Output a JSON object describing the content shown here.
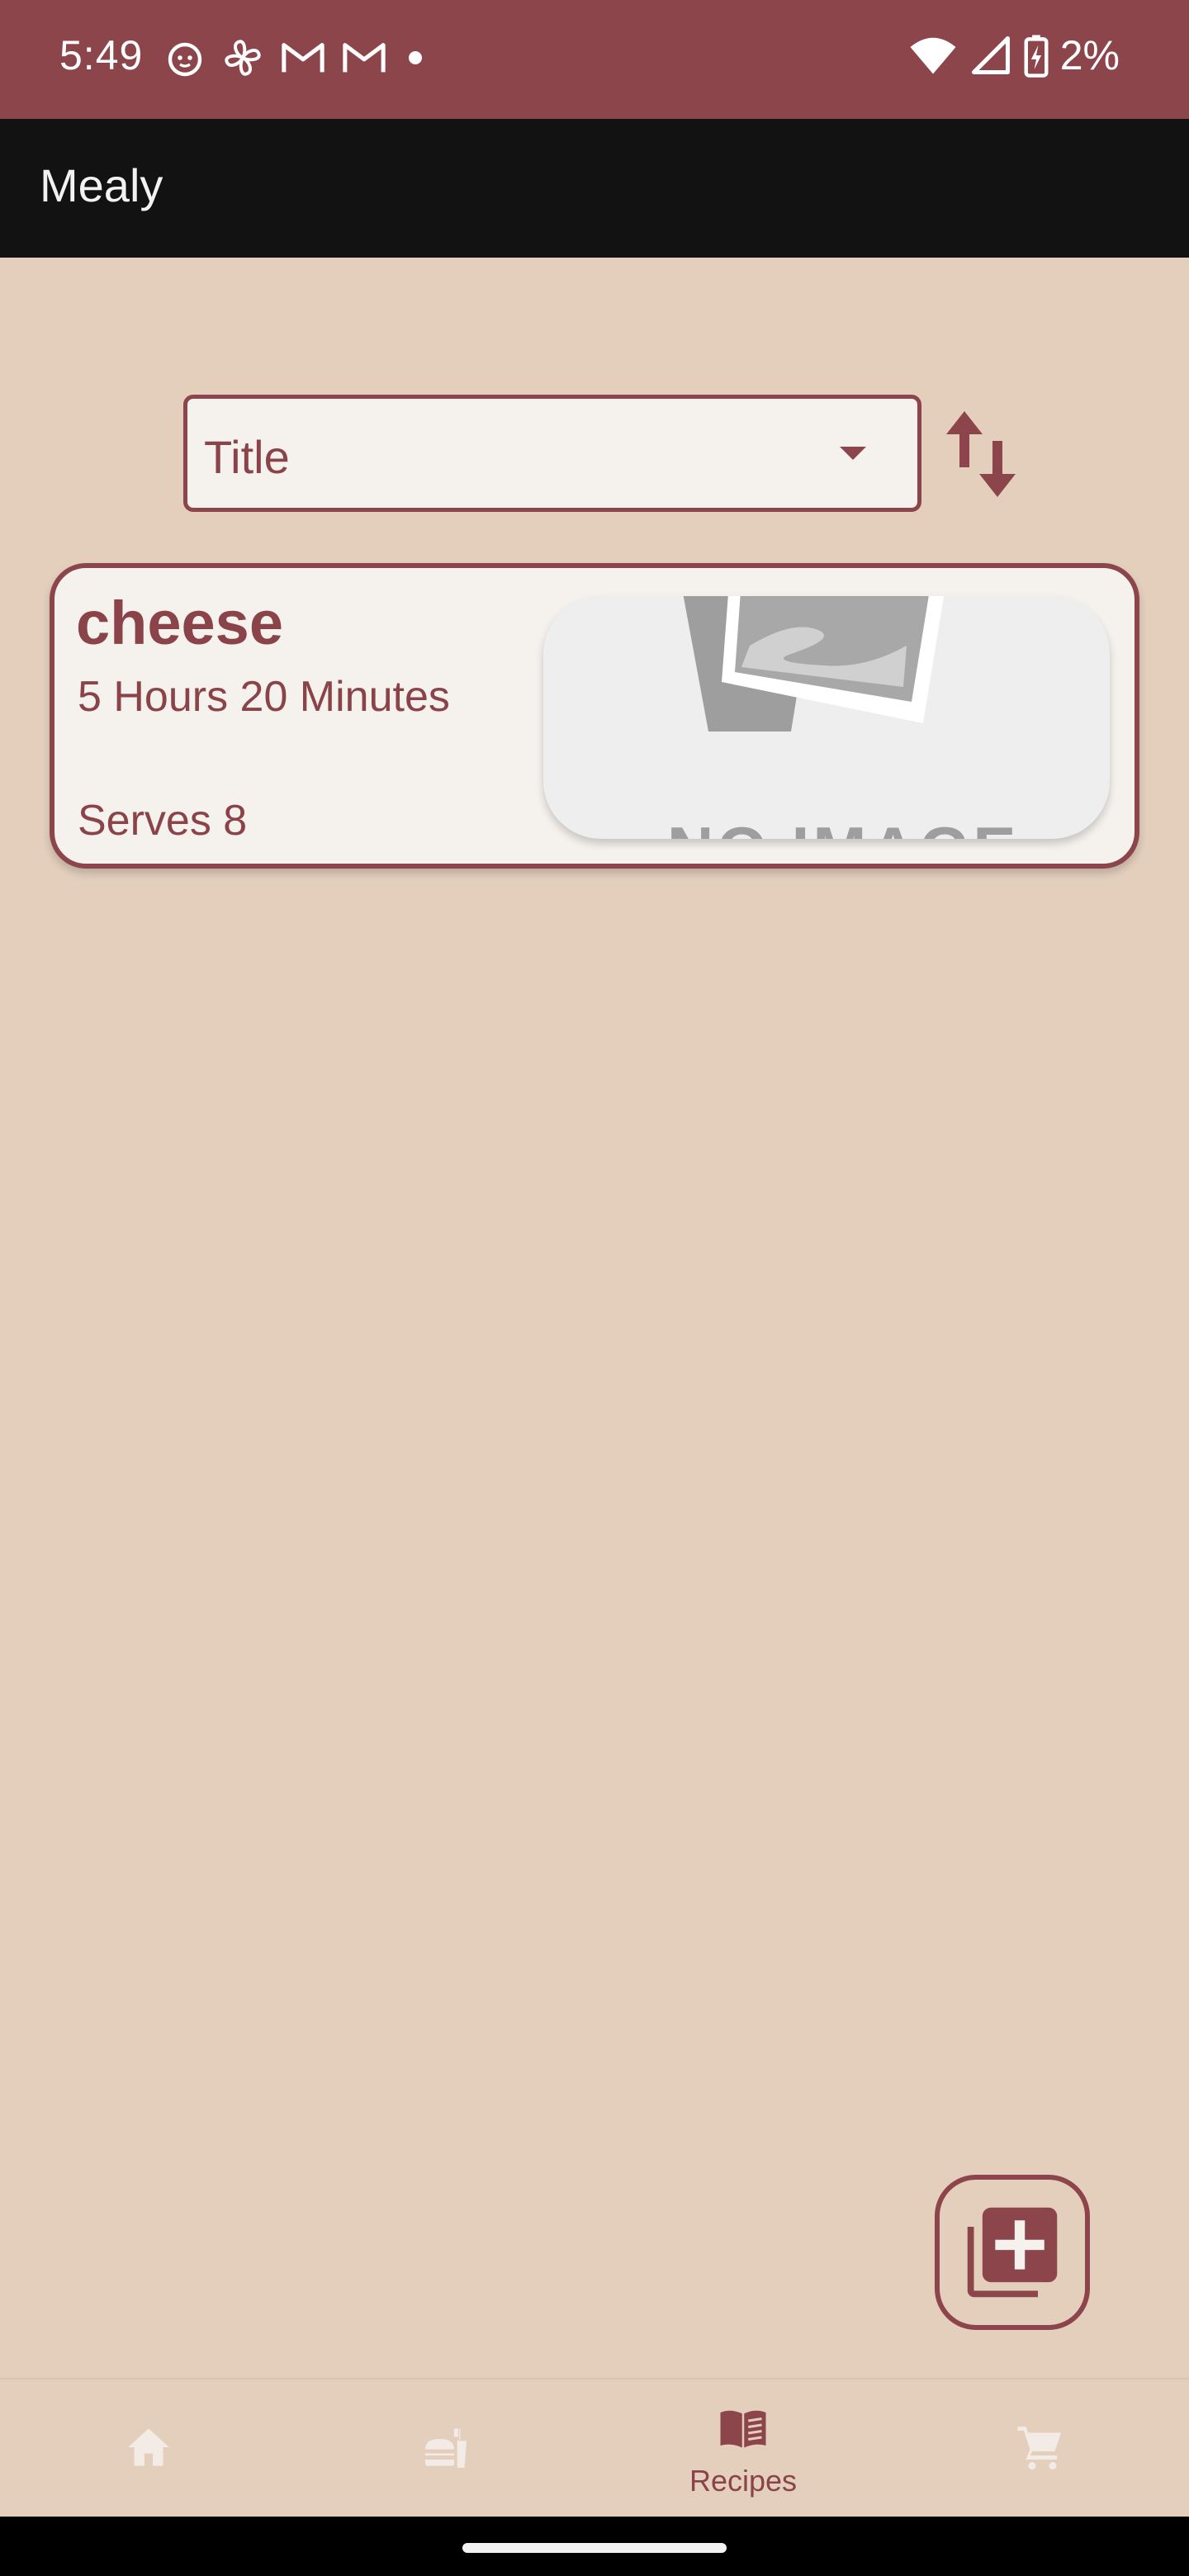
{
  "status_bar": {
    "time": "5:49",
    "battery": "2%",
    "left_icons": [
      "face-notification-icon",
      "fan-notification-icon",
      "gmail-icon",
      "gmail-icon",
      "dot-icon"
    ],
    "right_icons": [
      "wifi-icon",
      "signal-icon",
      "battery-charging-icon"
    ]
  },
  "app_bar": {
    "title": "Mealy"
  },
  "sort": {
    "selected": "Title",
    "order_icon": "swap-vertical-icon"
  },
  "recipes": [
    {
      "title": "cheese",
      "time": "5 Hours 20 Minutes",
      "serves": "Serves 8",
      "image_placeholder": "NO IMAGE"
    }
  ],
  "fab": {
    "icon": "library-add-icon"
  },
  "bottom_nav": {
    "items": [
      {
        "icon": "home-icon",
        "label": ""
      },
      {
        "icon": "meals-icon",
        "label": ""
      },
      {
        "icon": "recipes-book-icon",
        "label": "Recipes"
      },
      {
        "icon": "cart-icon",
        "label": ""
      }
    ],
    "active_index": 2
  },
  "colors": {
    "primary": "#8c464b",
    "background": "#e4cfbd",
    "surface": "#f5f1ed",
    "app_bar": "#121212",
    "inactive_icon": "#f3ece6"
  }
}
